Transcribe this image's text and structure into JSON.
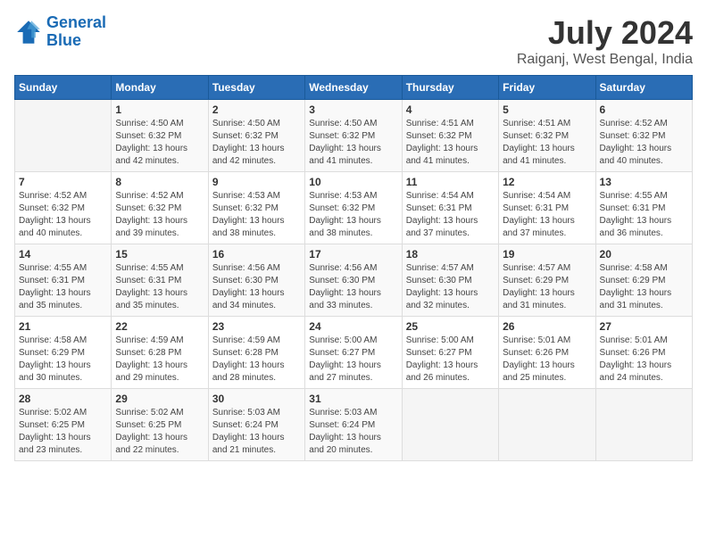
{
  "logo": {
    "line1": "General",
    "line2": "Blue"
  },
  "title": "July 2024",
  "subtitle": "Raiganj, West Bengal, India",
  "weekdays": [
    "Sunday",
    "Monday",
    "Tuesday",
    "Wednesday",
    "Thursday",
    "Friday",
    "Saturday"
  ],
  "weeks": [
    [
      {
        "day": "",
        "sunrise": "",
        "sunset": "",
        "daylight": ""
      },
      {
        "day": "1",
        "sunrise": "Sunrise: 4:50 AM",
        "sunset": "Sunset: 6:32 PM",
        "daylight": "Daylight: 13 hours and 42 minutes."
      },
      {
        "day": "2",
        "sunrise": "Sunrise: 4:50 AM",
        "sunset": "Sunset: 6:32 PM",
        "daylight": "Daylight: 13 hours and 42 minutes."
      },
      {
        "day": "3",
        "sunrise": "Sunrise: 4:50 AM",
        "sunset": "Sunset: 6:32 PM",
        "daylight": "Daylight: 13 hours and 41 minutes."
      },
      {
        "day": "4",
        "sunrise": "Sunrise: 4:51 AM",
        "sunset": "Sunset: 6:32 PM",
        "daylight": "Daylight: 13 hours and 41 minutes."
      },
      {
        "day": "5",
        "sunrise": "Sunrise: 4:51 AM",
        "sunset": "Sunset: 6:32 PM",
        "daylight": "Daylight: 13 hours and 41 minutes."
      },
      {
        "day": "6",
        "sunrise": "Sunrise: 4:52 AM",
        "sunset": "Sunset: 6:32 PM",
        "daylight": "Daylight: 13 hours and 40 minutes."
      }
    ],
    [
      {
        "day": "7",
        "sunrise": "Sunrise: 4:52 AM",
        "sunset": "Sunset: 6:32 PM",
        "daylight": "Daylight: 13 hours and 40 minutes."
      },
      {
        "day": "8",
        "sunrise": "Sunrise: 4:52 AM",
        "sunset": "Sunset: 6:32 PM",
        "daylight": "Daylight: 13 hours and 39 minutes."
      },
      {
        "day": "9",
        "sunrise": "Sunrise: 4:53 AM",
        "sunset": "Sunset: 6:32 PM",
        "daylight": "Daylight: 13 hours and 38 minutes."
      },
      {
        "day": "10",
        "sunrise": "Sunrise: 4:53 AM",
        "sunset": "Sunset: 6:32 PM",
        "daylight": "Daylight: 13 hours and 38 minutes."
      },
      {
        "day": "11",
        "sunrise": "Sunrise: 4:54 AM",
        "sunset": "Sunset: 6:31 PM",
        "daylight": "Daylight: 13 hours and 37 minutes."
      },
      {
        "day": "12",
        "sunrise": "Sunrise: 4:54 AM",
        "sunset": "Sunset: 6:31 PM",
        "daylight": "Daylight: 13 hours and 37 minutes."
      },
      {
        "day": "13",
        "sunrise": "Sunrise: 4:55 AM",
        "sunset": "Sunset: 6:31 PM",
        "daylight": "Daylight: 13 hours and 36 minutes."
      }
    ],
    [
      {
        "day": "14",
        "sunrise": "Sunrise: 4:55 AM",
        "sunset": "Sunset: 6:31 PM",
        "daylight": "Daylight: 13 hours and 35 minutes."
      },
      {
        "day": "15",
        "sunrise": "Sunrise: 4:55 AM",
        "sunset": "Sunset: 6:31 PM",
        "daylight": "Daylight: 13 hours and 35 minutes."
      },
      {
        "day": "16",
        "sunrise": "Sunrise: 4:56 AM",
        "sunset": "Sunset: 6:30 PM",
        "daylight": "Daylight: 13 hours and 34 minutes."
      },
      {
        "day": "17",
        "sunrise": "Sunrise: 4:56 AM",
        "sunset": "Sunset: 6:30 PM",
        "daylight": "Daylight: 13 hours and 33 minutes."
      },
      {
        "day": "18",
        "sunrise": "Sunrise: 4:57 AM",
        "sunset": "Sunset: 6:30 PM",
        "daylight": "Daylight: 13 hours and 32 minutes."
      },
      {
        "day": "19",
        "sunrise": "Sunrise: 4:57 AM",
        "sunset": "Sunset: 6:29 PM",
        "daylight": "Daylight: 13 hours and 31 minutes."
      },
      {
        "day": "20",
        "sunrise": "Sunrise: 4:58 AM",
        "sunset": "Sunset: 6:29 PM",
        "daylight": "Daylight: 13 hours and 31 minutes."
      }
    ],
    [
      {
        "day": "21",
        "sunrise": "Sunrise: 4:58 AM",
        "sunset": "Sunset: 6:29 PM",
        "daylight": "Daylight: 13 hours and 30 minutes."
      },
      {
        "day": "22",
        "sunrise": "Sunrise: 4:59 AM",
        "sunset": "Sunset: 6:28 PM",
        "daylight": "Daylight: 13 hours and 29 minutes."
      },
      {
        "day": "23",
        "sunrise": "Sunrise: 4:59 AM",
        "sunset": "Sunset: 6:28 PM",
        "daylight": "Daylight: 13 hours and 28 minutes."
      },
      {
        "day": "24",
        "sunrise": "Sunrise: 5:00 AM",
        "sunset": "Sunset: 6:27 PM",
        "daylight": "Daylight: 13 hours and 27 minutes."
      },
      {
        "day": "25",
        "sunrise": "Sunrise: 5:00 AM",
        "sunset": "Sunset: 6:27 PM",
        "daylight": "Daylight: 13 hours and 26 minutes."
      },
      {
        "day": "26",
        "sunrise": "Sunrise: 5:01 AM",
        "sunset": "Sunset: 6:26 PM",
        "daylight": "Daylight: 13 hours and 25 minutes."
      },
      {
        "day": "27",
        "sunrise": "Sunrise: 5:01 AM",
        "sunset": "Sunset: 6:26 PM",
        "daylight": "Daylight: 13 hours and 24 minutes."
      }
    ],
    [
      {
        "day": "28",
        "sunrise": "Sunrise: 5:02 AM",
        "sunset": "Sunset: 6:25 PM",
        "daylight": "Daylight: 13 hours and 23 minutes."
      },
      {
        "day": "29",
        "sunrise": "Sunrise: 5:02 AM",
        "sunset": "Sunset: 6:25 PM",
        "daylight": "Daylight: 13 hours and 22 minutes."
      },
      {
        "day": "30",
        "sunrise": "Sunrise: 5:03 AM",
        "sunset": "Sunset: 6:24 PM",
        "daylight": "Daylight: 13 hours and 21 minutes."
      },
      {
        "day": "31",
        "sunrise": "Sunrise: 5:03 AM",
        "sunset": "Sunset: 6:24 PM",
        "daylight": "Daylight: 13 hours and 20 minutes."
      },
      {
        "day": "",
        "sunrise": "",
        "sunset": "",
        "daylight": ""
      },
      {
        "day": "",
        "sunrise": "",
        "sunset": "",
        "daylight": ""
      },
      {
        "day": "",
        "sunrise": "",
        "sunset": "",
        "daylight": ""
      }
    ]
  ]
}
